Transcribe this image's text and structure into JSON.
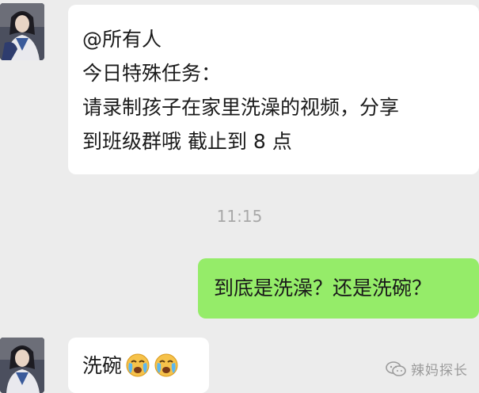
{
  "chat": {
    "messages": [
      {
        "sender": "other",
        "lines": [
          "@所有人",
          "今日特殊任务：",
          "请录制孩子在家里洗澡的视频，分享",
          "到班级群哦 截止到 8 点"
        ]
      },
      {
        "sender": "me",
        "text": "到底是洗澡？还是洗碗？"
      },
      {
        "sender": "other",
        "text": "洗碗",
        "emojis": [
          "crying-face-emoji",
          "crying-face-emoji"
        ]
      }
    ],
    "timestamp": "11:15"
  },
  "watermark": {
    "text": "辣妈探长",
    "icon": "wechat-logo-icon"
  },
  "colors": {
    "background": "#ececec",
    "bubble_left": "#ffffff",
    "bubble_right": "#95ec69",
    "timestamp": "#a8a8a8"
  }
}
